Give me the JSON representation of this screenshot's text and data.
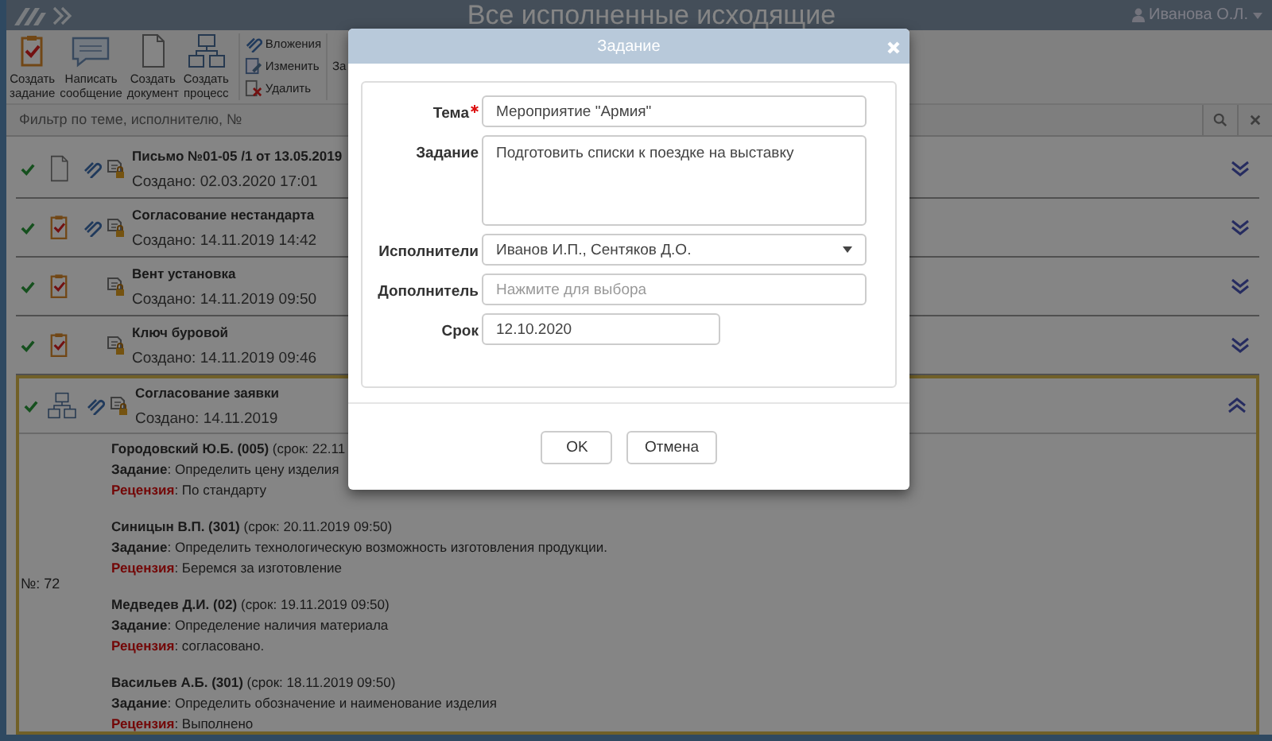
{
  "header": {
    "title": "Все исполненные исходящие",
    "user": "Иванова О.Л."
  },
  "toolbar": {
    "big_buttons": [
      {
        "kind": "task",
        "label": "Создать задание"
      },
      {
        "kind": "message",
        "label": "Написать сообщение"
      },
      {
        "kind": "document",
        "label": "Создать документ"
      },
      {
        "kind": "process",
        "label": "Создать процесс"
      }
    ],
    "small_buttons": [
      {
        "kind": "attach",
        "label": "Вложения"
      },
      {
        "kind": "edit",
        "label": "Изменить"
      },
      {
        "kind": "delete",
        "label": "Удалить"
      }
    ],
    "cut_label": "За"
  },
  "filter": {
    "placeholder": "Фильтр по теме, исполнителю, №"
  },
  "rows": [
    {
      "kind": "document",
      "attachment": true,
      "title": "Письмо №01-05 /1 от 13.05.2019",
      "created": "Создано: 02.03.2020 17:01",
      "expanded": false
    },
    {
      "kind": "task",
      "attachment": true,
      "title": "Согласование нестандарта",
      "created": "Создано: 14.11.2019 14:42",
      "expanded": false
    },
    {
      "kind": "task",
      "attachment": false,
      "title": "Вент установка",
      "created": "Создано: 14.11.2019 09:50",
      "expanded": false
    },
    {
      "kind": "task",
      "attachment": false,
      "title": "Ключ буровой",
      "created": "Создано: 14.11.2019 09:46",
      "expanded": false
    },
    {
      "kind": "process",
      "attachment": true,
      "title": "Согласование заявки",
      "created": "Создано: 14.11.2019",
      "expanded": true,
      "number": "№: 72",
      "assignees": [
        {
          "head": "**Городовский Ю.Б. (005)** (срок: 22.11",
          "task": "**Задание**: Определить цену изделия",
          "review": "**Рецензия**: По стандарту"
        },
        {
          "head": "**Синицын В.П. (301)** (срок: 20.11.2019 09:50)",
          "task": "**Задание**: Определить технологическую возможность изготовления продукции.",
          "review": "**Рецензия**: Беремся за изготовление"
        },
        {
          "head": "**Медведев Д.И. (02)** (срок: 19.11.2019 09:50)",
          "task": "**Задание**: Определение наличия материала",
          "review": "**Рецензия**: согласовано."
        },
        {
          "head": "**Васильев А.Б. (301)** (срок: 18.11.2019 09:50)",
          "task": "**Задание**: Определить обозначение и наименование изделия",
          "review": "**Рецензия**: Выполнено"
        }
      ]
    }
  ],
  "dialog": {
    "title": "Задание",
    "fields": [
      {
        "kind": "text",
        "label": "Тема",
        "required": true,
        "value": "Мероприятие \"Армия\""
      },
      {
        "kind": "textarea",
        "label": "Задание",
        "required": false,
        "value": "Подготовить списки к поездке на выставку"
      },
      {
        "kind": "select",
        "label": "Исполнители",
        "required": false,
        "value": "Иванов И.П., Сентяков Д.О."
      },
      {
        "kind": "text",
        "label": "Дополнитель",
        "required": false,
        "placeholder": "Нажмите для выбора"
      },
      {
        "kind": "date",
        "label": "Срок",
        "required": false,
        "value": "12.10.2020"
      }
    ],
    "buttons": [
      "OK",
      "Отмена"
    ]
  }
}
